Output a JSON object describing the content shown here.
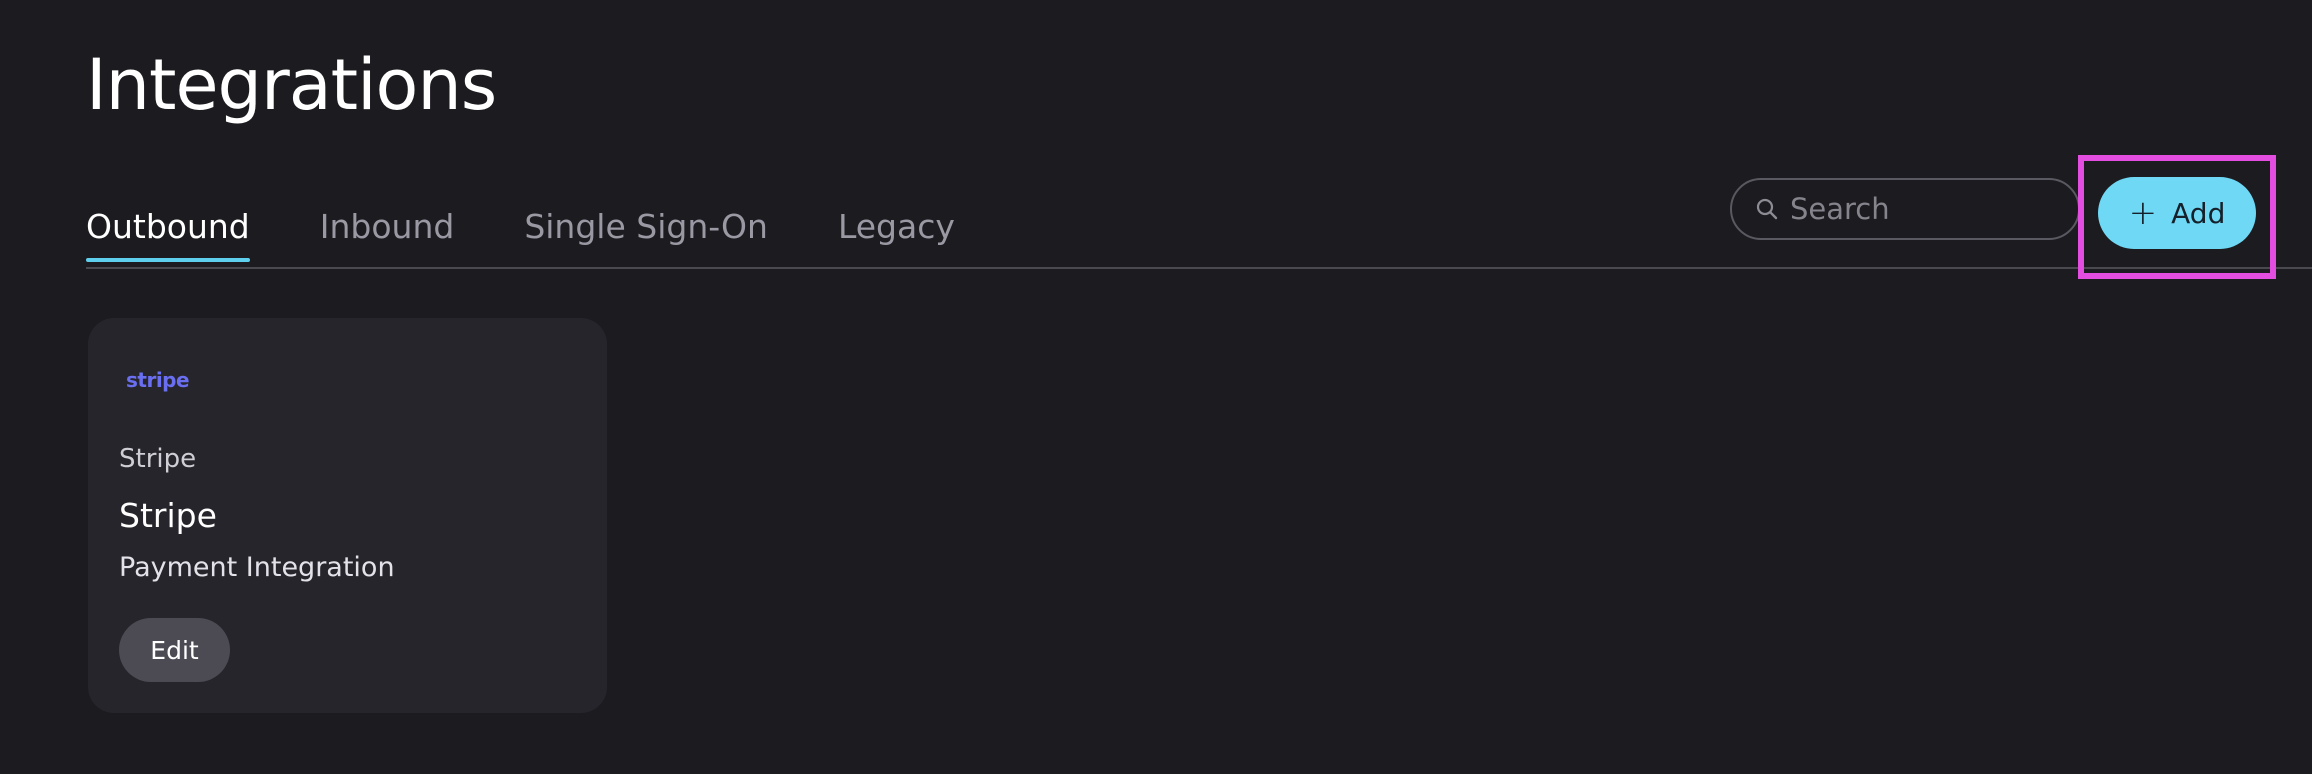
{
  "page": {
    "title": "Integrations"
  },
  "tabs": [
    {
      "label": "Outbound",
      "active": true
    },
    {
      "label": "Inbound",
      "active": false
    },
    {
      "label": "Single Sign-On",
      "active": false
    },
    {
      "label": "Legacy",
      "active": false
    }
  ],
  "search": {
    "placeholder": "Search",
    "value": "",
    "icon": "search-icon"
  },
  "add_button": {
    "label": "Add",
    "icon": "plus-icon",
    "highlighted": true
  },
  "integrations": [
    {
      "logo_text": "stripe",
      "provider": "Stripe",
      "name": "Stripe",
      "description": "Payment Integration",
      "edit_label": "Edit"
    }
  ],
  "colors": {
    "background": "#1c1b20",
    "card_background": "#26252b",
    "accent": "#6ed8f5",
    "tab_indicator": "#5fcfee",
    "highlight": "#e44ee0",
    "stripe_brand": "#6a6ff2",
    "edit_button": "#4c4b54"
  }
}
